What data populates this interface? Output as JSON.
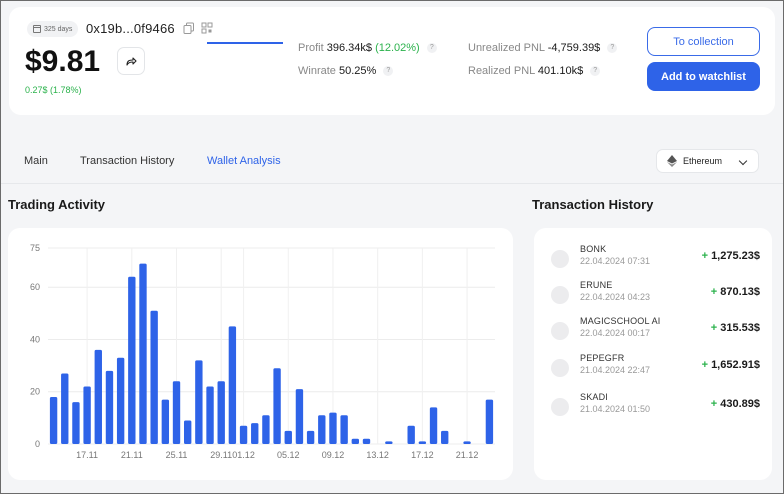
{
  "header": {
    "days_badge": "325 days",
    "address": "0x19b...0f9466",
    "price": "$9.81",
    "price_change": "0.27$ (1.78%)",
    "profit_label": "Profit",
    "profit_value": "396.34k$",
    "profit_pct": "(12.02%)",
    "winrate_label": "Winrate",
    "winrate_value": "50.25%",
    "unrealized_label": "Unrealized PNL",
    "unrealized_value": "-4,759.39$",
    "realized_label": "Realized PNL",
    "realized_value": "401.10k$",
    "help_mark": "?",
    "to_collection_label": "To collection",
    "add_watchlist_label": "Add to watchlist"
  },
  "tabs": [
    {
      "label": "Main",
      "active": false
    },
    {
      "label": "Transaction History",
      "active": false
    },
    {
      "label": "Wallet Analysis",
      "active": true
    }
  ],
  "network": {
    "selected": "Ethereum"
  },
  "trading_activity": {
    "title": "Trading Activity"
  },
  "transaction_history": {
    "title": "Transaction History",
    "items": [
      {
        "token": "BONK",
        "date": "22.04.2024 07:31",
        "sign": "+",
        "amount": "1,275.23$"
      },
      {
        "token": "ERUNE",
        "date": "22.04.2024 04:23",
        "sign": "+",
        "amount": "870.13$"
      },
      {
        "token": "MAGICSCHOOL AI",
        "date": "22.04.2024 00:17",
        "sign": "+",
        "amount": "315.53$"
      },
      {
        "token": "PEPEGFR",
        "date": "21.04.2024 22:47",
        "sign": "+",
        "amount": "1,652.91$"
      },
      {
        "token": "SKADI",
        "date": "21.04.2024 01:50",
        "sign": "+",
        "amount": "430.89$"
      }
    ]
  },
  "colors": {
    "accent": "#2e63e8",
    "positive": "#2bb24c",
    "bar": "#2e63e8"
  },
  "chart_data": {
    "type": "bar",
    "title": "Trading Activity",
    "ylim": [
      0,
      75
    ],
    "yticks": [
      0,
      20,
      40,
      60,
      75
    ],
    "grid": true,
    "xtick_labels": [
      "17.11",
      "21.11",
      "25.11",
      "29.11",
      "01.12",
      "05.12",
      "09.12",
      "13.12",
      "17.12",
      "21.12"
    ],
    "xtick_positions": [
      3,
      7,
      11,
      15,
      17,
      21,
      25,
      29,
      33,
      37
    ],
    "values": [
      18,
      27,
      16,
      22,
      36,
      28,
      33,
      64,
      69,
      51,
      17,
      24,
      9,
      32,
      22,
      24,
      45,
      7,
      8,
      11,
      29,
      5,
      21,
      5,
      11,
      12,
      11,
      2,
      2,
      0,
      1,
      0,
      7,
      1,
      14,
      5,
      0,
      1,
      0,
      17
    ]
  }
}
